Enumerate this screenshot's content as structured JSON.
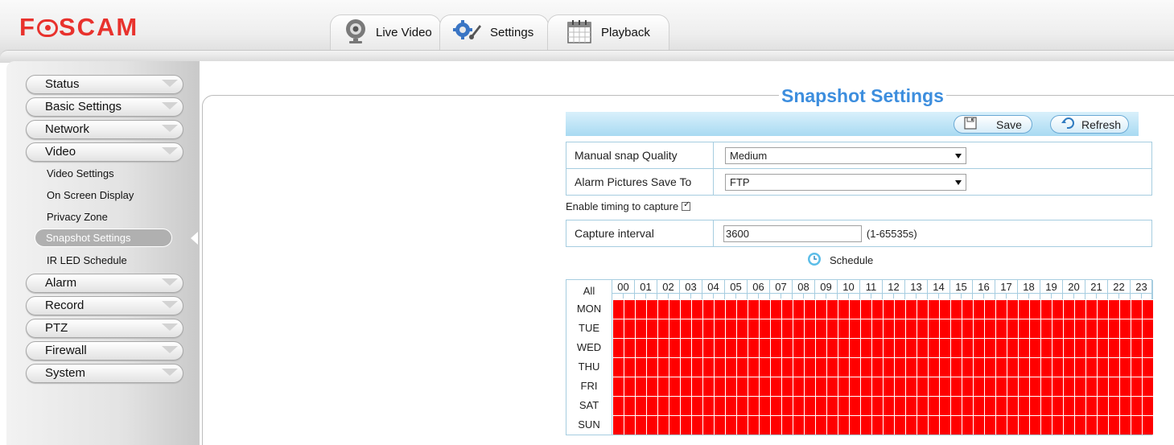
{
  "brand": {
    "logo_text": "FOSCAM",
    "color": "#e8322d"
  },
  "tabs": [
    {
      "label": "Live Video",
      "icon": "webcam-icon"
    },
    {
      "label": "Settings",
      "icon": "gears-icon"
    },
    {
      "label": "Playback",
      "icon": "calendar-icon"
    }
  ],
  "sidebar": {
    "menus": [
      {
        "label": "Status"
      },
      {
        "label": "Basic Settings"
      },
      {
        "label": "Network"
      },
      {
        "label": "Video"
      },
      {
        "label": "Alarm"
      },
      {
        "label": "Record"
      },
      {
        "label": "PTZ"
      },
      {
        "label": "Firewall"
      },
      {
        "label": "System"
      }
    ],
    "video_subitems": [
      {
        "label": "Video Settings"
      },
      {
        "label": "On Screen Display"
      },
      {
        "label": "Privacy Zone"
      },
      {
        "label": "Snapshot Settings",
        "active": true
      },
      {
        "label": "IR LED Schedule"
      }
    ]
  },
  "page": {
    "title": "Snapshot Settings",
    "title_color": "#3d8ede",
    "buttons": {
      "save": "Save",
      "refresh": "Refresh"
    },
    "fields": {
      "quality_label": "Manual snap Quality",
      "quality_value": "Medium",
      "save_to_label": "Alarm Pictures Save To",
      "save_to_value": "FTP",
      "enable_timing_label": "Enable timing to capture",
      "enable_timing_checked": true,
      "interval_label": "Capture interval",
      "interval_value": "3600",
      "interval_hint": "(1-65535s)"
    },
    "schedule": {
      "title": "Schedule",
      "all_label": "All",
      "hours": [
        "00",
        "01",
        "02",
        "03",
        "04",
        "05",
        "06",
        "07",
        "08",
        "09",
        "10",
        "11",
        "12",
        "13",
        "14",
        "15",
        "16",
        "17",
        "18",
        "19",
        "20",
        "21",
        "22",
        "23"
      ],
      "days": [
        "MON",
        "TUE",
        "WED",
        "THU",
        "FRI",
        "SAT",
        "SUN"
      ],
      "all_selected": true,
      "selected_color": "#ff0000"
    }
  }
}
